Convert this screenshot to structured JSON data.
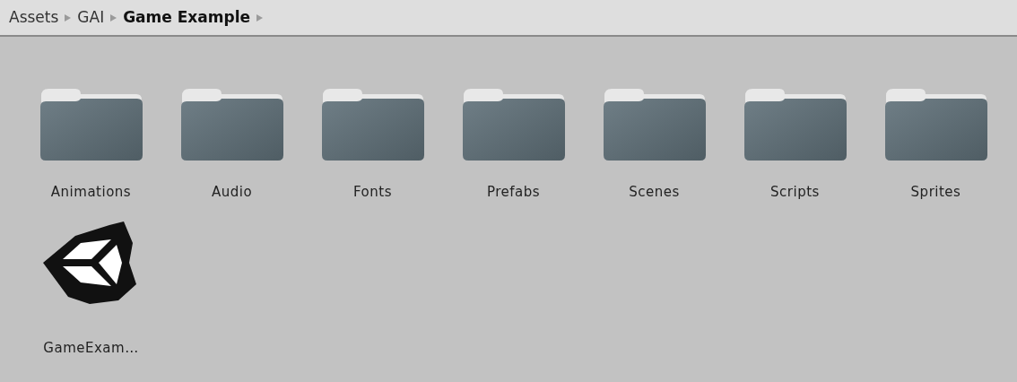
{
  "breadcrumb": [
    {
      "label": "Assets",
      "current": false
    },
    {
      "label": "GAI",
      "current": false
    },
    {
      "label": "Game Example",
      "current": true
    }
  ],
  "assets": [
    {
      "kind": "folder",
      "label": "Animations"
    },
    {
      "kind": "folder",
      "label": "Audio"
    },
    {
      "kind": "folder",
      "label": "Fonts"
    },
    {
      "kind": "folder",
      "label": "Prefabs"
    },
    {
      "kind": "folder",
      "label": "Scenes"
    },
    {
      "kind": "folder",
      "label": "Scripts"
    },
    {
      "kind": "folder",
      "label": "Sprites"
    },
    {
      "kind": "scene",
      "label": "GameExam…"
    }
  ]
}
